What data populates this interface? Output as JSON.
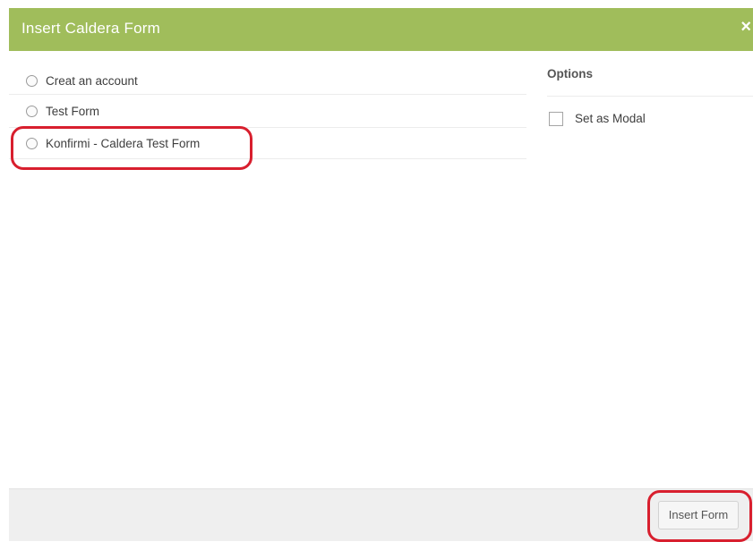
{
  "dialog": {
    "title": "Insert Caldera Form",
    "close_icon": "close-icon",
    "close_symbol": "×"
  },
  "forms": [
    {
      "label": "Creat an account",
      "selected": false
    },
    {
      "label": "Test Form",
      "selected": false
    },
    {
      "label": "Konfirmi - Caldera Test Form",
      "selected": false,
      "highlighted": true
    }
  ],
  "options": {
    "heading": "Options",
    "set_as_modal": {
      "label": "Set as Modal",
      "checked": false
    }
  },
  "footer": {
    "insert_label": "Insert Form"
  },
  "colors": {
    "titlebar": "#a0bd5b",
    "highlight": "#d81f2e",
    "footer": "#efefef"
  }
}
